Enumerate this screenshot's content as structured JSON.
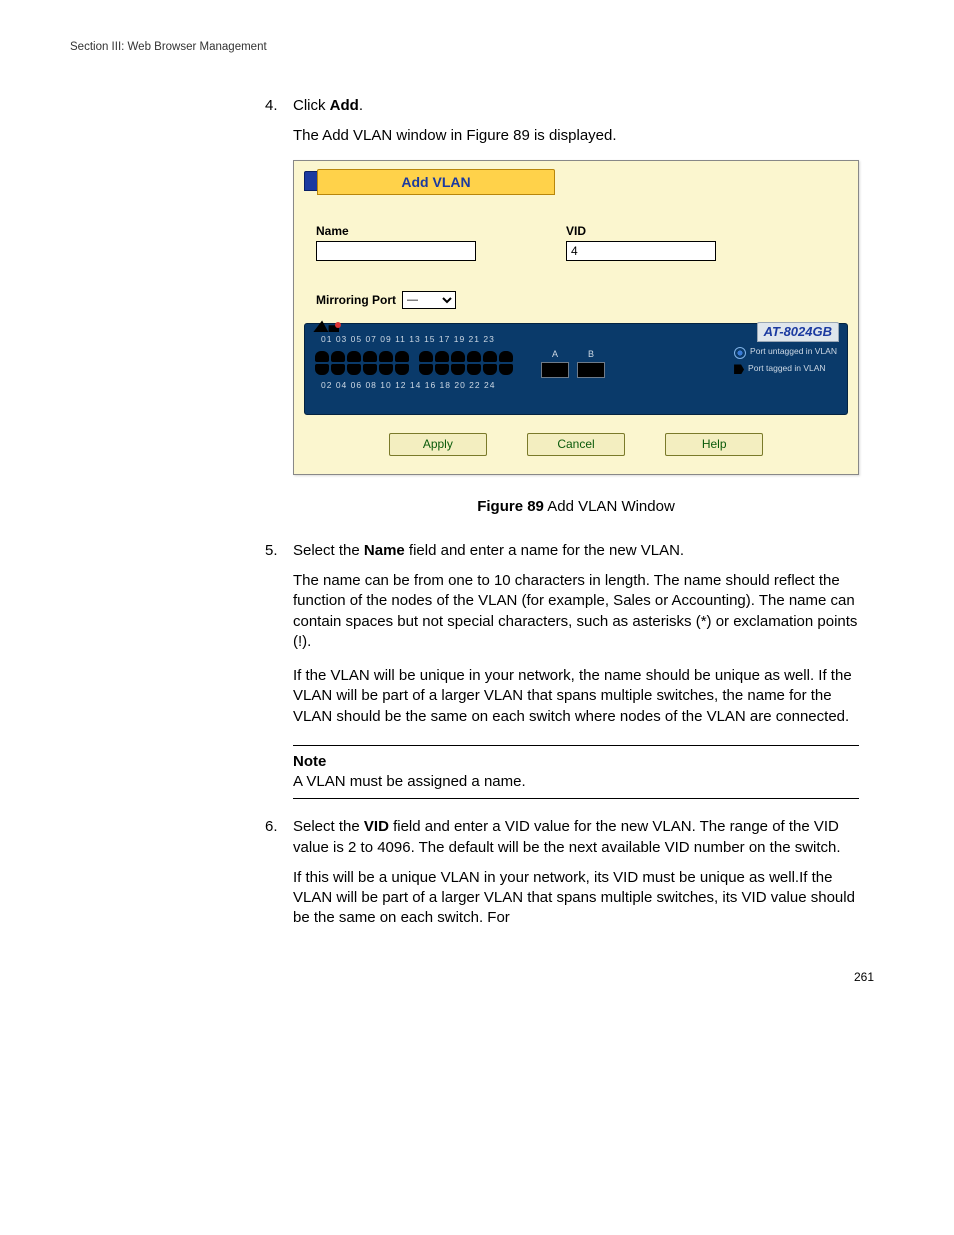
{
  "running_head": "Section III: Web Browser Management",
  "page_number": "261",
  "steps": {
    "s4": {
      "num": "4.",
      "line": {
        "pre": "Click ",
        "bold": "Add",
        "post": "."
      },
      "after": "The Add VLAN window in Figure 89 is displayed."
    },
    "s5": {
      "num": "5.",
      "line": {
        "pre": "Select the ",
        "bold": "Name",
        "post": " field and enter a name for the new VLAN."
      },
      "p1": "The name can be from one to 10 characters in length. The name should reflect the function of the nodes of the VLAN (for example, Sales or Accounting). The name can contain spaces but not special characters, such as asterisks (*) or exclamation points (!).",
      "p2": "If the VLAN will be unique in your network, the name should be unique as well. If the VLAN will be part of a larger VLAN that spans multiple switches, the name for the VLAN should be the same on each switch where nodes of the VLAN are connected."
    },
    "note": {
      "title": "Note",
      "body": "A VLAN must be assigned a name."
    },
    "s6": {
      "num": "6.",
      "line": {
        "pre": "Select the ",
        "bold": "VID",
        "post": " field and enter a VID value for the new VLAN. The range of the VID value is 2 to 4096. The default will be the next available VID number on the switch."
      },
      "p1": "If this will be a unique VLAN in your network, its VID must be unique as well.If the VLAN will be part of a larger VLAN that spans multiple switches, its VID value should be the same on each switch. For"
    }
  },
  "figure": {
    "caption_bold": "Figure 89",
    "caption_rest": "  Add VLAN Window",
    "tab_title": "Add VLAN",
    "labels": {
      "name": "Name",
      "vid": "VID",
      "mirroring": "Mirroring Port"
    },
    "values": {
      "name": "",
      "vid": "4",
      "mirroring": "—"
    },
    "model": "AT-8024GB",
    "port_numbers_top": "01  03  05  07  09  11      13  15  17  19  21  23",
    "port_numbers_bot": "02  04  06  08  10  12      14  16  18  20  22  24",
    "uplinks": {
      "a": "A",
      "b": "B"
    },
    "legend": {
      "untagged": "Port untagged in VLAN",
      "tagged": "Port tagged in VLAN"
    },
    "buttons": {
      "apply": "Apply",
      "cancel": "Cancel",
      "help": "Help"
    }
  }
}
